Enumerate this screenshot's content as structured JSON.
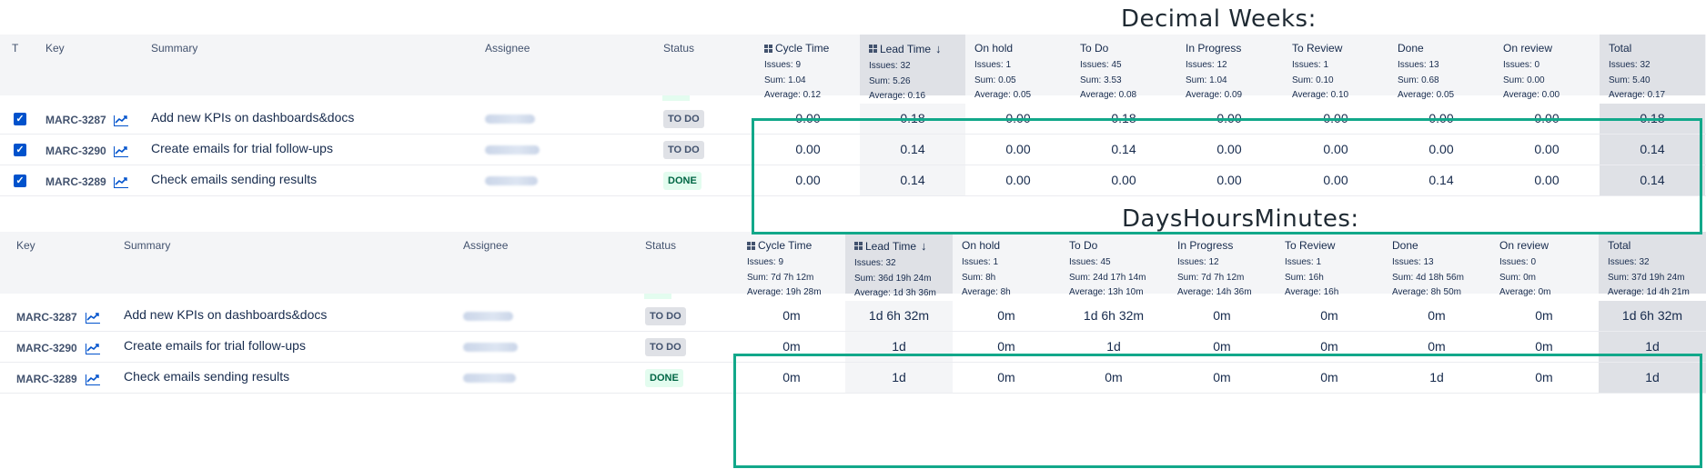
{
  "captions": {
    "top": "Decimal Weeks:",
    "bottom": "DaysHoursMinutes:"
  },
  "colors": {
    "frame": "#12a88a",
    "link": "#0052cc",
    "todo_bg": "#dfe1e6",
    "done_bg": "#e3fcef",
    "done_text": "#006644"
  },
  "top_table": {
    "headers": {
      "t": "T",
      "key": "Key",
      "summary": "Summary",
      "assignee": "Assignee",
      "status": "Status"
    },
    "metric_columns": [
      {
        "title": "Cycle Time",
        "icon": "grid-icon",
        "issues": "Issues: 9",
        "sum": "Sum: 1.04",
        "average": "Average: 0.12"
      },
      {
        "title": "Lead Time",
        "icon": "grid-icon",
        "sorted": "sort-desc-icon",
        "issues": "Issues: 32",
        "sum": "Sum: 5.26",
        "average": "Average: 0.16"
      },
      {
        "title": "On hold",
        "issues": "Issues: 1",
        "sum": "Sum: 0.05",
        "average": "Average: 0.05"
      },
      {
        "title": "To Do",
        "issues": "Issues: 45",
        "sum": "Sum: 3.53",
        "average": "Average: 0.08"
      },
      {
        "title": "In Progress",
        "issues": "Issues: 12",
        "sum": "Sum: 1.04",
        "average": "Average: 0.09"
      },
      {
        "title": "To Review",
        "issues": "Issues: 1",
        "sum": "Sum: 0.10",
        "average": "Average: 0.10"
      },
      {
        "title": "Done",
        "issues": "Issues: 13",
        "sum": "Sum: 0.68",
        "average": "Average: 0.05"
      },
      {
        "title": "On review",
        "issues": "Issues: 0",
        "sum": "Sum: 0.00",
        "average": "Average: 0.00"
      },
      {
        "title": "Total",
        "issues": "Issues: 32",
        "sum": "Sum: 5.40",
        "average": "Average: 0.17"
      }
    ],
    "rows": [
      {
        "key": "MARC-3287",
        "summary": "Add new KPIs on dashboards&docs",
        "status": "TO DO",
        "values": [
          "0.00",
          "0.18",
          "0.00",
          "0.18",
          "0.00",
          "0.00",
          "0.00",
          "0.00",
          "0.18"
        ]
      },
      {
        "key": "MARC-3290",
        "summary": "Create emails for trial follow-ups",
        "status": "TO DO",
        "values": [
          "0.00",
          "0.14",
          "0.00",
          "0.14",
          "0.00",
          "0.00",
          "0.00",
          "0.00",
          "0.14"
        ]
      },
      {
        "key": "MARC-3289",
        "summary": "Check emails sending results",
        "status": "DONE",
        "values": [
          "0.00",
          "0.14",
          "0.00",
          "0.00",
          "0.00",
          "0.00",
          "0.14",
          "0.00",
          "0.14"
        ]
      }
    ]
  },
  "bottom_table": {
    "headers": {
      "key": "Key",
      "summary": "Summary",
      "assignee": "Assignee",
      "status": "Status"
    },
    "metric_columns": [
      {
        "title": "Cycle Time",
        "icon": "grid-icon",
        "issues": "Issues: 9",
        "sum": "Sum: 7d 7h 12m",
        "average": "Average: 19h 28m"
      },
      {
        "title": "Lead Time",
        "icon": "grid-icon",
        "sorted": "sort-desc-icon",
        "issues": "Issues: 32",
        "sum": "Sum: 36d 19h 24m",
        "average": "Average: 1d 3h 36m"
      },
      {
        "title": "On hold",
        "issues": "Issues: 1",
        "sum": "Sum: 8h",
        "average": "Average: 8h"
      },
      {
        "title": "To Do",
        "issues": "Issues: 45",
        "sum": "Sum: 24d 17h 14m",
        "average": "Average: 13h 10m"
      },
      {
        "title": "In Progress",
        "issues": "Issues: 12",
        "sum": "Sum: 7d 7h 12m",
        "average": "Average: 14h 36m"
      },
      {
        "title": "To Review",
        "issues": "Issues: 1",
        "sum": "Sum: 16h",
        "average": "Average: 16h"
      },
      {
        "title": "Done",
        "issues": "Issues: 13",
        "sum": "Sum: 4d 18h 56m",
        "average": "Average: 8h 50m"
      },
      {
        "title": "On review",
        "issues": "Issues: 0",
        "sum": "Sum: 0m",
        "average": "Average: 0m"
      },
      {
        "title": "Total",
        "issues": "Issues: 32",
        "sum": "Sum: 37d 19h 24m",
        "average": "Average: 1d 4h 21m"
      }
    ],
    "rows": [
      {
        "key": "MARC-3287",
        "summary": "Add new KPIs on dashboards&docs",
        "status": "TO DO",
        "values": [
          "0m",
          "1d 6h 32m",
          "0m",
          "1d 6h 32m",
          "0m",
          "0m",
          "0m",
          "0m",
          "1d 6h 32m"
        ]
      },
      {
        "key": "MARC-3290",
        "summary": "Create emails for trial follow-ups",
        "status": "TO DO",
        "values": [
          "0m",
          "1d",
          "0m",
          "1d",
          "0m",
          "0m",
          "0m",
          "0m",
          "1d"
        ]
      },
      {
        "key": "MARC-3289",
        "summary": "Check emails sending results",
        "status": "DONE",
        "values": [
          "0m",
          "1d",
          "0m",
          "0m",
          "0m",
          "0m",
          "1d",
          "0m",
          "1d"
        ]
      }
    ]
  }
}
